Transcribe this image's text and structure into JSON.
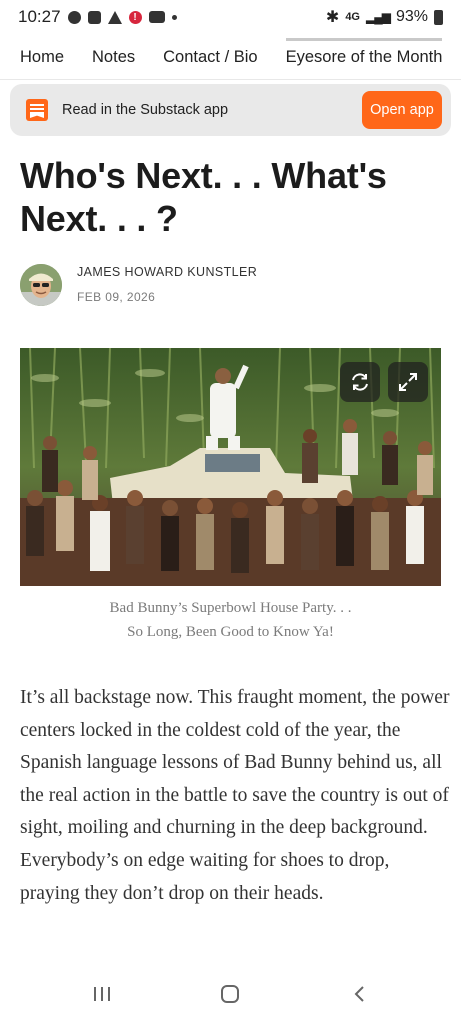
{
  "status": {
    "time": "10:27",
    "network": "4G",
    "battery": "93%"
  },
  "nav": {
    "items": [
      "Home",
      "Notes",
      "Contact / Bio",
      "Eyesore of the Month"
    ]
  },
  "banner": {
    "text": "Read in the Substack app",
    "button": "Open app",
    "accent": "#ff6719"
  },
  "post": {
    "title": "Who's Next. . . What's Next. . . ?",
    "author": "JAMES HOWARD KUNSTLER",
    "date": "FEB 09, 2026",
    "caption_line1": "Bad Bunny’s Superbowl House Party. . .",
    "caption_line2": "So Long, Been Good to Know Ya!",
    "body": "It’s all backstage now. This fraught moment, the power centers locked in the coldest cold of the year, the Spanish language lessons of Bad Bunny behind us, all the real action in the battle to save the country is out of sight, moiling and churning in the deep background. Everybody’s on edge waiting for shoes to drop, praying they don’t drop on their heads."
  },
  "icons": {
    "refresh": "refresh-icon",
    "expand": "expand-icon",
    "substack": "substack-logo-icon"
  }
}
